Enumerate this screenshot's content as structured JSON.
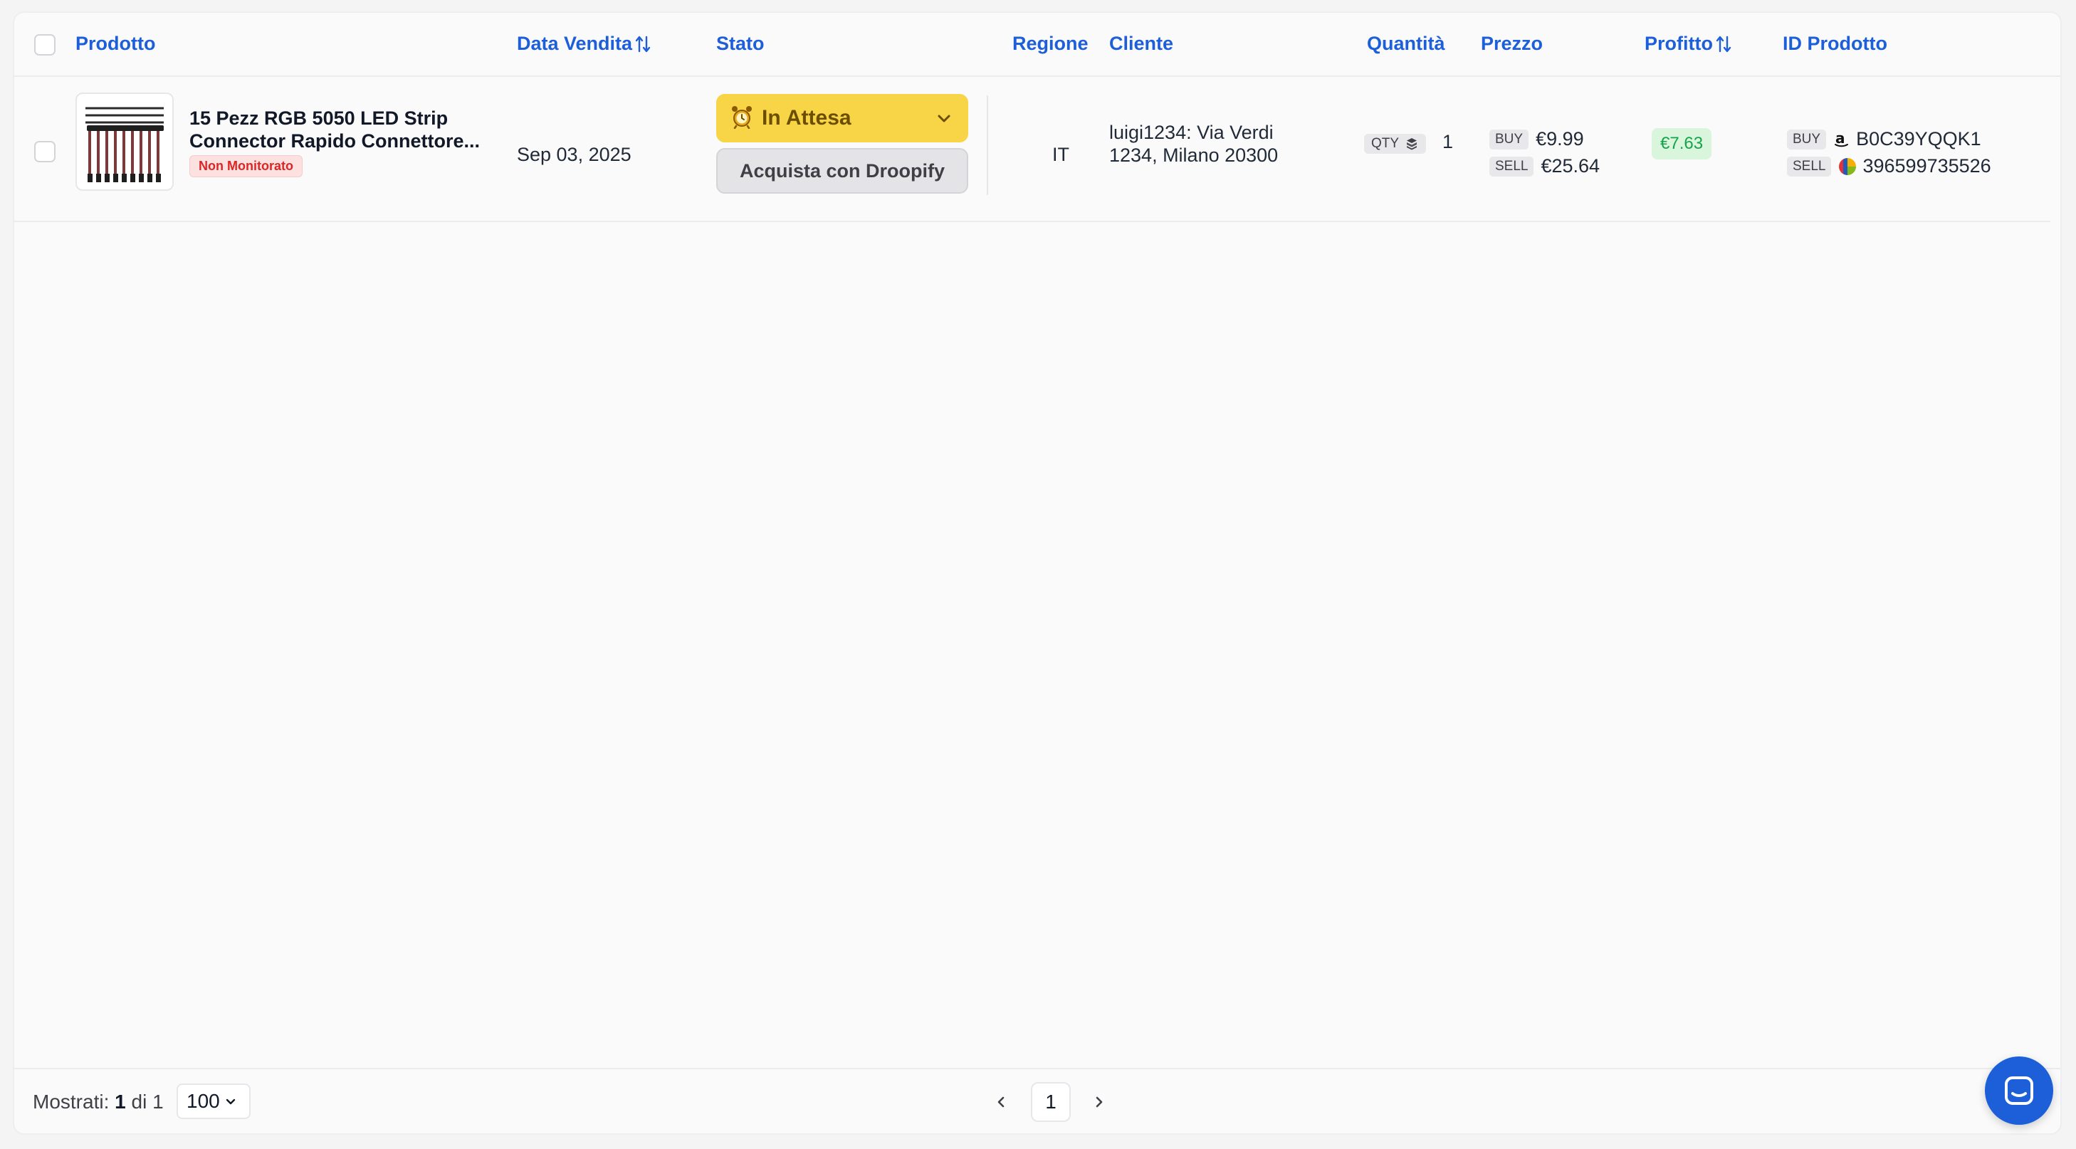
{
  "header": {
    "product": "Prodotto",
    "sale_date": "Data Vendita",
    "status": "Stato",
    "region": "Regione",
    "customer": "Cliente",
    "quantity": "Quantità",
    "price": "Prezzo",
    "profit": "Profitto",
    "product_id": "ID Prodotto"
  },
  "rows": [
    {
      "product_name_line1": "15 Pezz RGB 5050 LED Strip",
      "product_name_line2": "Connector Rapido Connettore...",
      "badge": "Non Monitorato",
      "sale_date": "Sep 03, 2025",
      "status": "In Attesa",
      "action_button": "Acquista con Droopify",
      "region": "IT",
      "customer_line1": "luigi1234: Via Verdi",
      "customer_line2": "1234, Milano 20300",
      "qty_label": "QTY",
      "qty_value": "1",
      "buy_label": "BUY",
      "buy_price": "€9.99",
      "sell_label": "SELL",
      "sell_price": "€25.64",
      "profit": "€7.63",
      "buy_id": "B0C39YQQK1",
      "sell_id": "396599735526"
    }
  ],
  "footer": {
    "shown_label": "Mostrati:",
    "shown_count": "1",
    "of_label": "di",
    "total": "1",
    "per_page": "100",
    "current_page": "1"
  },
  "colors": {
    "accent": "#1d5fd8",
    "status_pending": "#f8d447",
    "profit_bg": "#d9f6dd",
    "profit_text": "#16a34a",
    "badge_bg": "#fde1e1",
    "badge_text": "#dc2626"
  },
  "icons": {
    "sort": "sort-arrows-icon",
    "status": "alarm-clock-icon",
    "qty": "box-icon",
    "buy_marketplace": "amazon-icon",
    "sell_marketplace": "ebay-icon",
    "chat": "chat-icon"
  }
}
